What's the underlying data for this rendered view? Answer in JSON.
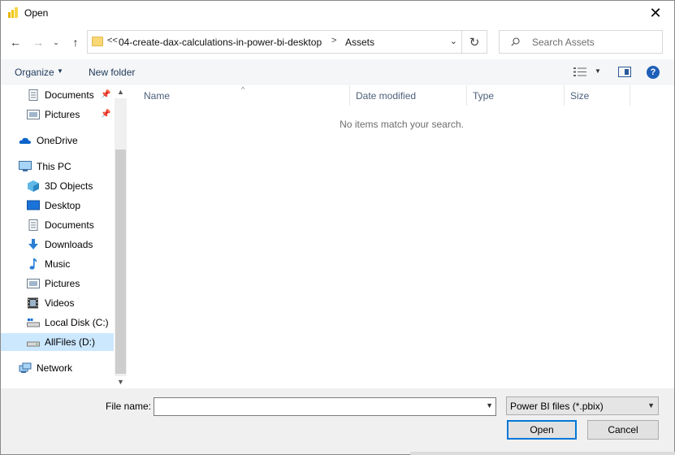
{
  "window": {
    "title": "Open"
  },
  "navigation": {
    "breadcrumb_prefix": "<<",
    "path": [
      "04-create-dax-calculations-in-power-bi-desktop",
      "Assets"
    ],
    "separator": ">"
  },
  "search": {
    "placeholder": "Search Assets"
  },
  "toolbar": {
    "organize_label": "Organize",
    "new_folder_label": "New folder",
    "help_label": "?"
  },
  "sidebar": {
    "items": [
      {
        "label": "Documents",
        "icon": "document-icon",
        "pinned": true
      },
      {
        "label": "Pictures",
        "icon": "pictures-icon",
        "pinned": true
      },
      {
        "label": "OneDrive",
        "icon": "onedrive-icon"
      },
      {
        "label": "This PC",
        "icon": "pc-icon"
      },
      {
        "label": "3D Objects",
        "icon": "cube-icon"
      },
      {
        "label": "Desktop",
        "icon": "desktop-icon"
      },
      {
        "label": "Documents",
        "icon": "document-icon"
      },
      {
        "label": "Downloads",
        "icon": "download-icon"
      },
      {
        "label": "Music",
        "icon": "music-icon"
      },
      {
        "label": "Pictures",
        "icon": "pictures-icon"
      },
      {
        "label": "Videos",
        "icon": "video-icon"
      },
      {
        "label": "Local Disk (C:)",
        "icon": "drive-icon"
      },
      {
        "label": "AllFiles (D:)",
        "icon": "drive-icon",
        "selected": true
      },
      {
        "label": "Network",
        "icon": "network-icon"
      }
    ]
  },
  "file_list": {
    "columns": [
      "Name",
      "Date modified",
      "Type",
      "Size"
    ],
    "empty_message": "No items match your search."
  },
  "footer": {
    "file_name_label": "File name:",
    "file_name_value": "",
    "file_type_filter": "Power BI files (*.pbix)",
    "open_label": "Open",
    "cancel_label": "Cancel"
  },
  "colors": {
    "accent": "#0078d7",
    "selection": "#cce8ff",
    "folder": "#f8d775"
  }
}
